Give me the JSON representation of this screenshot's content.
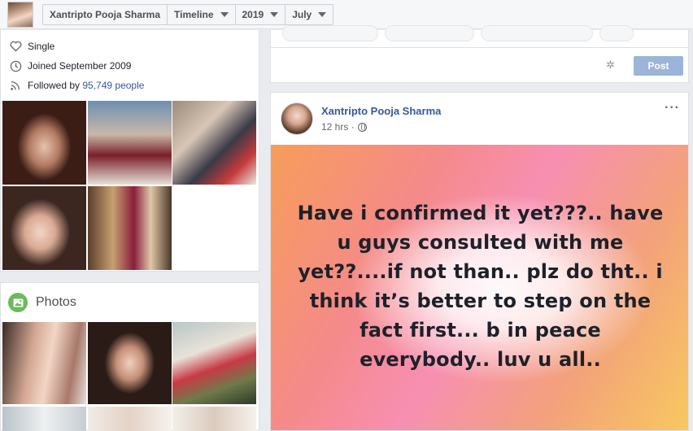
{
  "topbar": {
    "profile_name": "Xantripto Pooja Sharma",
    "timeline_label": "Timeline",
    "year_label": "2019",
    "month_label": "July"
  },
  "intro": {
    "relationship": "Single",
    "joined": "Joined September 2009",
    "followed_prefix": "Followed by ",
    "followers_count": "95,749 people"
  },
  "photos": {
    "title": "Photos"
  },
  "composer": {
    "post_button": "Post"
  },
  "post": {
    "author": "Xantripto Pooja Sharma",
    "time": "12 hrs",
    "separator": "·",
    "text": "Have i confirmed it yet???.. have u guys consulted with me yet??....if not than.. plz do tht.. i think it’s better to step on the fact first... b in peace everybody.. luv u all..",
    "more_icon": "···"
  },
  "colors": {
    "link": "#385898",
    "post_button_bg": "#9cb4d8",
    "photos_badge": "#6bba5d"
  }
}
